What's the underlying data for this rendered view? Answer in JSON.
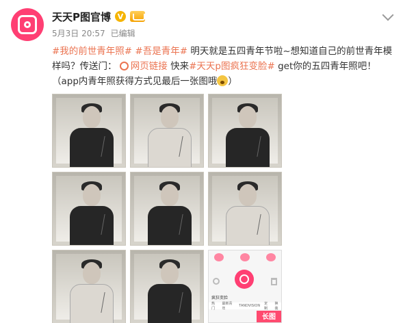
{
  "account": {
    "name": "天天P图官博",
    "verify_badge": "V",
    "vip_icon": "vip-icon"
  },
  "meta": {
    "date": "5月3日 20:57",
    "edited": "已编辑"
  },
  "post": {
    "tag1": "#我的前世青年照#",
    "tag2": "#吾是青年#",
    "text1": " 明天就是五四青年节啦~想知道自己的前世青年模",
    "text2_prefix": "样吗？传送门：",
    "link_text": "网页链接",
    "text2_mid": " 快来",
    "tag3": "#天天p图疯狂变脸#",
    "text2_suffix": " get你的五四青年照吧！",
    "text3": "（app内青年照获得方式见最后一张图哦"
  },
  "phone": {
    "title": "疯狂变脸",
    "tabs": [
      "热门",
      "最新青年",
      "TANDVISION",
      "定制",
      "换装"
    ],
    "banner": "长图"
  },
  "colors": {
    "brand": "#ff3f73",
    "link": "#eb7350",
    "vip": "#f5b400"
  }
}
